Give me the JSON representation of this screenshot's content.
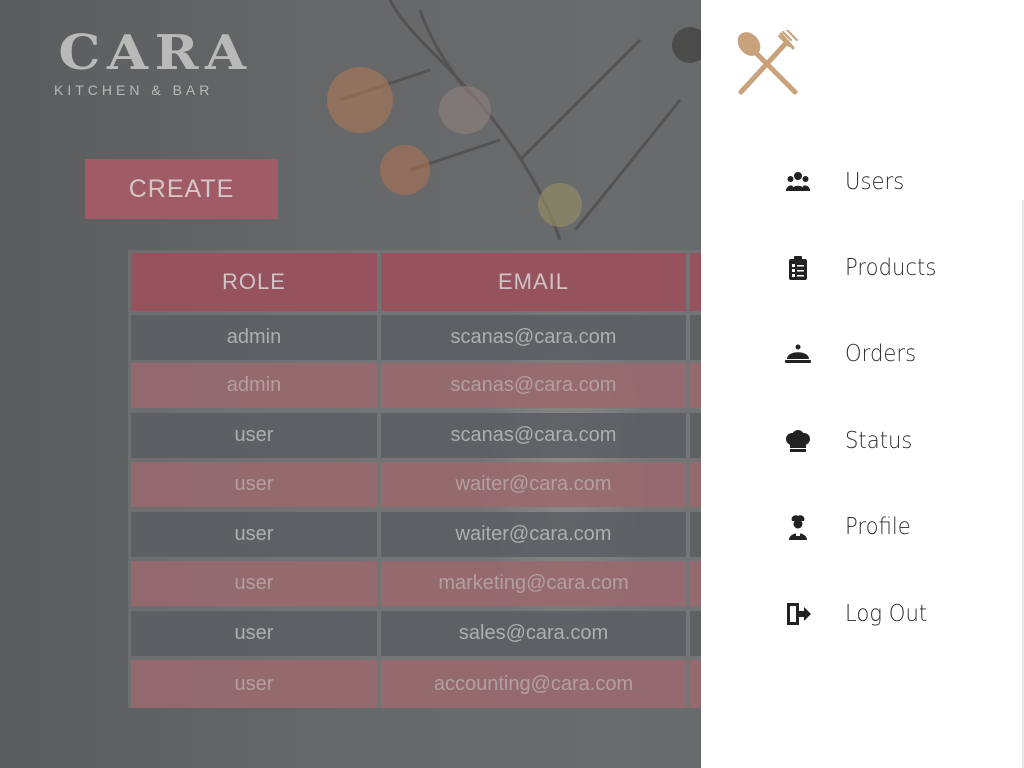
{
  "brand": {
    "name": "CARA",
    "subtitle": "KITCHEN & BAR"
  },
  "actions": {
    "create_label": "CREATE"
  },
  "table": {
    "headers": [
      "ROLE",
      "EMAIL"
    ],
    "rows": [
      {
        "role": "admin",
        "email": "scanas@cara.com"
      },
      {
        "role": "admin",
        "email": "scanas@cara.com"
      },
      {
        "role": "user",
        "email": "scanas@cara.com"
      },
      {
        "role": "user",
        "email": "waiter@cara.com"
      },
      {
        "role": "user",
        "email": "waiter@cara.com"
      },
      {
        "role": "user",
        "email": "marketing@cara.com"
      },
      {
        "role": "user",
        "email": "sales@cara.com"
      },
      {
        "role": "user",
        "email": "accounting@cara.com"
      }
    ]
  },
  "drawer": {
    "logo_icon": "fork-spoon-icon",
    "items": [
      {
        "label": "Users",
        "icon": "users-icon"
      },
      {
        "label": "Products",
        "icon": "clipboard-list-icon"
      },
      {
        "label": "Orders",
        "icon": "cloche-icon"
      },
      {
        "label": "Status",
        "icon": "chef-hat-icon"
      },
      {
        "label": "Profile",
        "icon": "chef-person-icon"
      },
      {
        "label": "Log Out",
        "icon": "logout-icon"
      }
    ]
  },
  "colors": {
    "accent_rose": "#96525d",
    "logo_gold": "#c7a27a",
    "drawer_bg": "#ffffff"
  }
}
